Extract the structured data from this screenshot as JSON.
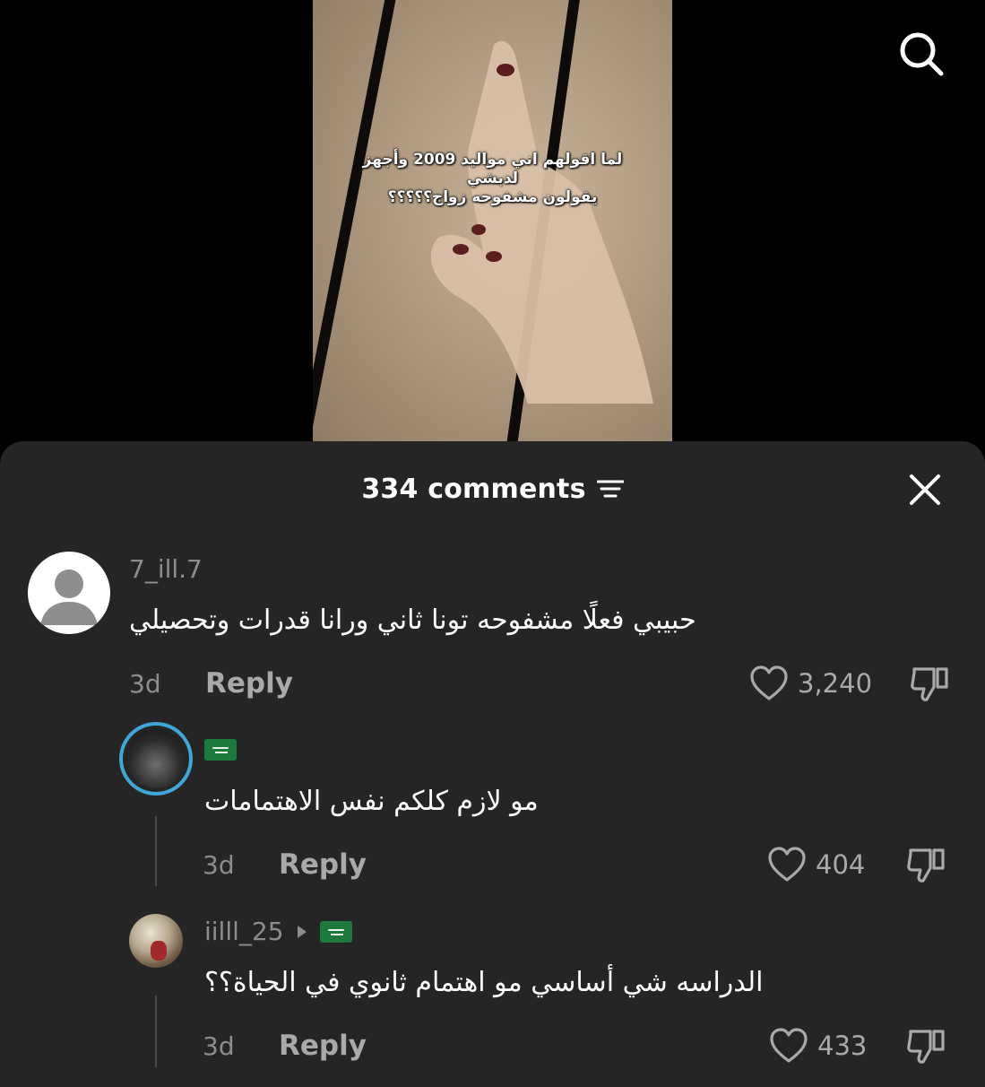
{
  "video": {
    "caption_line1": "لما اقولهم اني مواليد 2009 وأجهز لدبشي",
    "caption_line2": "يقولون مشفوحه زواج؟؟؟؟؟",
    "search_icon": "search-icon"
  },
  "comments_panel": {
    "title": "334 comments",
    "sort_icon": "sort-icon",
    "close_icon": "close-icon"
  },
  "comments": [
    {
      "username": "7_ill.7",
      "text": "حبيبي فعلًا مشفوحه تونا ثاني ورانا قدرات وتحصيلي",
      "time": "3d",
      "reply_label": "Reply",
      "likes": "3,240"
    },
    {
      "username": "",
      "username_flag": "saudi-flag-icon",
      "text": "مو لازم كلكم نفس الاهتمامات",
      "time": "3d",
      "reply_label": "Reply",
      "likes": "404"
    },
    {
      "username": "iilll_25",
      "username_flag": "saudi-flag-icon",
      "text": "الدراسه شي أساسي مو اهتمام ثانوي في الحياة؟؟",
      "time": "3d",
      "reply_label": "Reply",
      "likes": "433"
    }
  ],
  "colors": {
    "sheet_bg": "#252525",
    "muted_text": "#8d8d8d",
    "accent_ring": "#3ea6d8"
  }
}
